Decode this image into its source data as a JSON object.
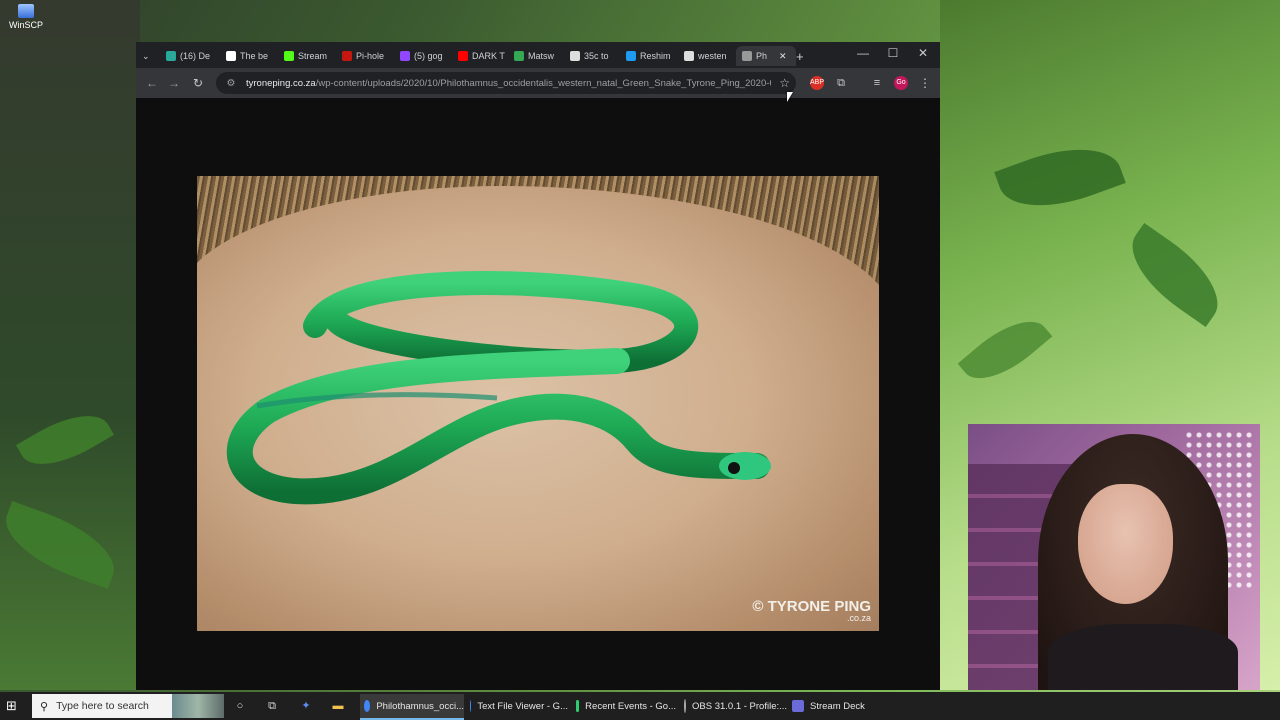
{
  "desktop": {
    "icons": [
      {
        "label": "WinSCP",
        "icon": "winscp-icon"
      }
    ]
  },
  "browser": {
    "tabs": [
      {
        "label": "(16) De",
        "color": "#2aa89a"
      },
      {
        "label": "The be",
        "color": "#ffffff"
      },
      {
        "label": "Stream",
        "color": "#53fc18"
      },
      {
        "label": "Pi-hole",
        "color": "#c4170f"
      },
      {
        "label": "(5) gog",
        "color": "#9146ff"
      },
      {
        "label": "DARK T",
        "color": "#ff0000"
      },
      {
        "label": "Matsw",
        "color": "#34a853"
      },
      {
        "label": "35c to",
        "color": "#dddddd"
      },
      {
        "label": "Reshim",
        "color": "#1d9bf0"
      },
      {
        "label": "westen",
        "color": "#dddddd"
      },
      {
        "label": "Ph",
        "color": "#999999",
        "active": true
      }
    ],
    "new_tab_label": "+",
    "window_controls": {
      "minimize": "—",
      "maximize": "☐",
      "close": "✕"
    },
    "url_host": "tyroneping.co.za",
    "url_path": "/wp-content/uploads/2020/10/Philothamnus_occidentalis_western_natal_Green_Snake_Tyrone_Ping_2020-6-10...",
    "extensions": [
      "ABP",
      "Go"
    ],
    "image_watermark": "© TYRONE PING",
    "image_watermark_sub": ".co.za"
  },
  "taskbar": {
    "search_placeholder": "Type here to search",
    "apps": [
      {
        "label": "Philothamnus_occi...",
        "color": "#4285f4",
        "active": true
      },
      {
        "label": "Text File Viewer - G...",
        "color": "#4285f4"
      },
      {
        "label": "Recent Events - Go...",
        "color": "#2ecc71"
      },
      {
        "label": "OBS 31.0.1 - Profile:...",
        "color": "#444444"
      },
      {
        "label": "Stream Deck",
        "color": "#6a6ad8"
      }
    ]
  }
}
